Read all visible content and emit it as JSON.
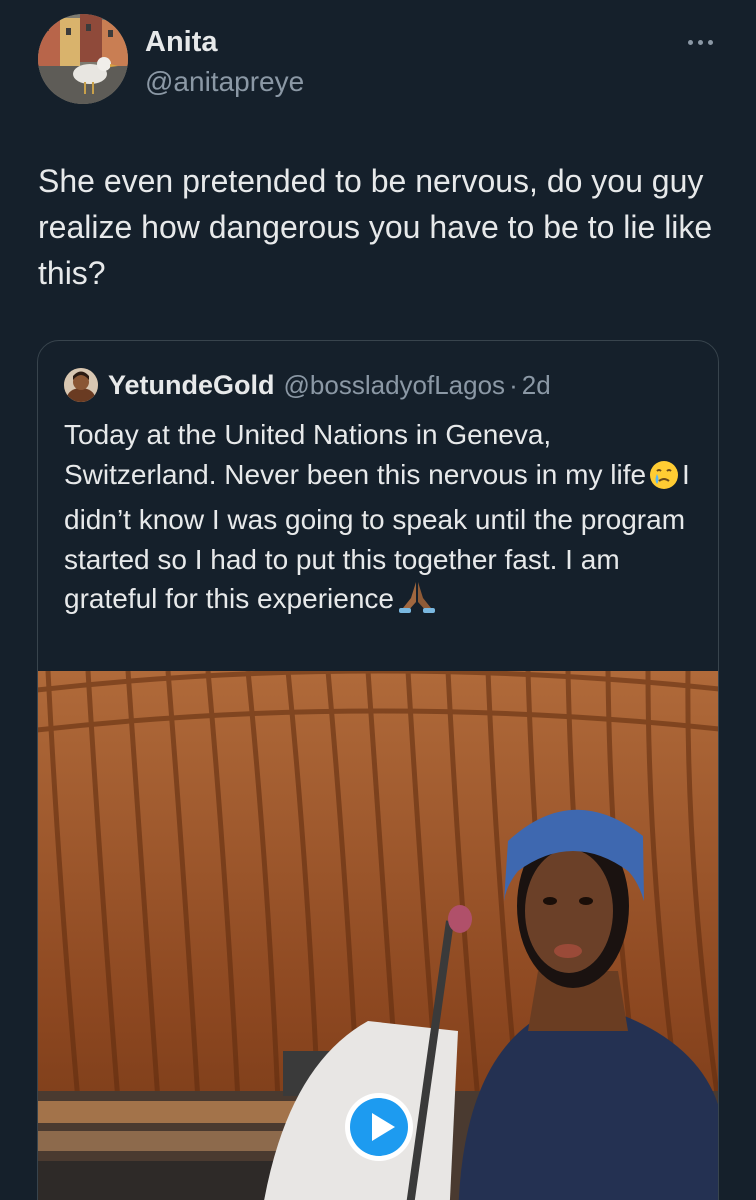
{
  "tweet": {
    "author": {
      "display_name": "Anita",
      "handle": "@anitapreye",
      "avatar_icon": "avatar-photo"
    },
    "more_icon": "more-options-icon",
    "text": "She even pretended to be nervous, do you guy realize how dangerous you have to be to lie like this?"
  },
  "quoted_tweet": {
    "author": {
      "display_name": "YetundeGold",
      "handle": "@bossladyofLagos",
      "avatar_icon": "avatar-photo"
    },
    "separator": "·",
    "time": "2d",
    "text_line1": "Today at the United Nations in Geneva, Switzerland. Never been this nervous in my life",
    "text_line2": "I didn’t know I was going to speak until the program started so I had to put this together fast. I am grateful for this experience",
    "emoji_1": "crying-face-emoji",
    "emoji_2": "praying-hands-emoji",
    "media": {
      "type": "video",
      "play_icon": "play-icon"
    }
  },
  "colors": {
    "background": "#15202b",
    "text_primary": "#e7e9ea",
    "text_secondary": "#8b98a5",
    "border": "#38444d",
    "play_button": "#1d9bf0"
  }
}
